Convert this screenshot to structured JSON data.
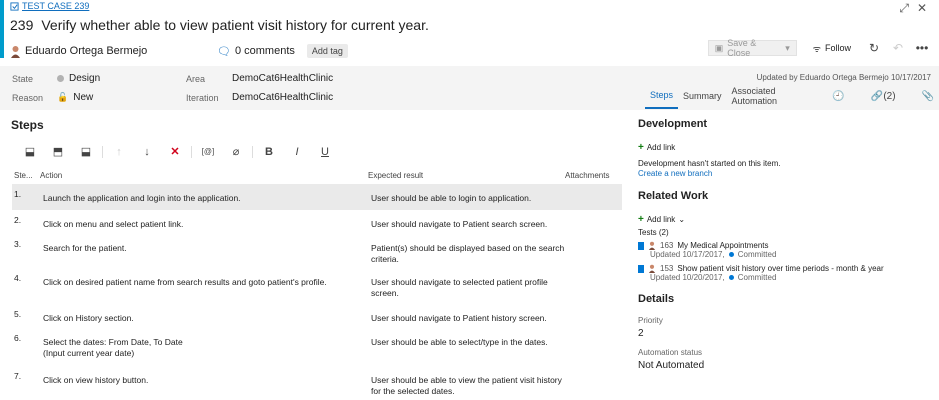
{
  "header": {
    "test_case_link": "TEST CASE 239",
    "id": "239",
    "title": "Verify whether able to view patient visit history for current year.",
    "assignee": "Eduardo Ortega Bermejo",
    "comments": "0 comments",
    "add_tag": "Add tag",
    "save_close": "Save & Close",
    "follow": "Follow",
    "updated_by": "Updated by Eduardo Ortega Bermejo 10/17/2017"
  },
  "fields": {
    "state_label": "State",
    "state_value": "Design",
    "reason_label": "Reason",
    "reason_value": "New",
    "area_label": "Area",
    "area_value": "DemoCat6HealthClinic",
    "iteration_label": "Iteration",
    "iteration_value": "DemoCat6HealthClinic"
  },
  "tabs": {
    "steps": "Steps",
    "summary": "Summary",
    "automation": "Associated Automation",
    "links_count": "(2)"
  },
  "steps": {
    "title": "Steps",
    "columns": {
      "num": "Ste...",
      "action": "Action",
      "expected": "Expected result",
      "attachments": "Attachments"
    },
    "rows": [
      {
        "num": "1.",
        "action": "Launch the application and login into the application.",
        "expected": "User should be able to login to application."
      },
      {
        "num": "2.",
        "action": "Click on menu and select patient link.",
        "expected": "User should navigate to Patient search screen."
      },
      {
        "num": "3.",
        "action": "Search for the patient.",
        "expected": "Patient(s) should be displayed based on the search criteria."
      },
      {
        "num": "4.",
        "action": "Click on desired patient name from search results and goto patient's profile.",
        "expected": "User should navigate to selected patient profile screen."
      },
      {
        "num": "5.",
        "action": "Click on History section.",
        "expected": "User should navigate to Patient history screen."
      },
      {
        "num": "6.",
        "action": "Select the dates: From Date, To Date\n(Input current year date)",
        "expected": "User should be able to select/type in the dates."
      },
      {
        "num": "7.",
        "action": "Click on view history button.",
        "expected": "User should be able to view the patient visit history for the selected dates."
      }
    ]
  },
  "development": {
    "title": "Development",
    "add_link": "Add link",
    "message": "Development hasn't started on this item.",
    "create_branch": "Create a new branch"
  },
  "related": {
    "title": "Related Work",
    "add_link": "Add link",
    "tests_label": "Tests (2)",
    "items": [
      {
        "id": "163",
        "title": "My Medical Appointments",
        "updated": "Updated 10/17/2017,",
        "state": "Committed"
      },
      {
        "id": "153",
        "title": "Show patient visit history over time periods - month & year",
        "updated": "Updated 10/20/2017,",
        "state": "Committed"
      }
    ]
  },
  "details": {
    "title": "Details",
    "priority_label": "Priority",
    "priority_value": "2",
    "automation_label": "Automation status",
    "automation_value": "Not Automated"
  },
  "colors": {
    "accent": "#009ccc",
    "link": "#106ebe",
    "selected_row": "#eaeaea",
    "delete": "#d0021b",
    "add": "#107c10"
  }
}
